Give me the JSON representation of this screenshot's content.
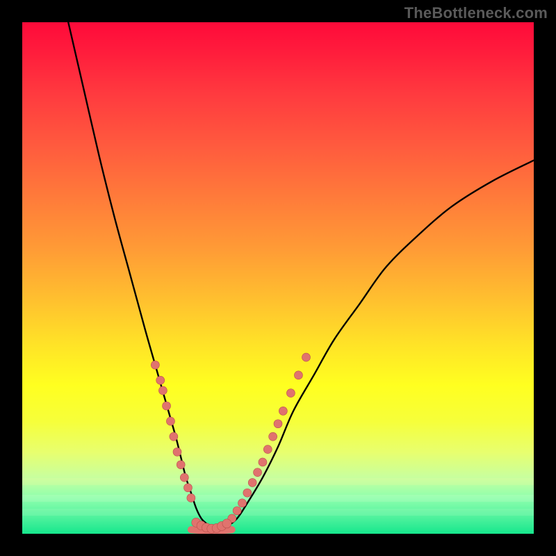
{
  "watermark": "TheBottleneck.com",
  "chart_data": {
    "type": "line",
    "title": "",
    "xlabel": "",
    "ylabel": "",
    "xlim": [
      0,
      100
    ],
    "ylim": [
      0,
      100
    ],
    "grid": false,
    "legend": false,
    "notes": "V-shaped black curve over a vertical red→yellow→green gradient. Red/salmon dots cluster near the valley on both arms; a short salmon stroke traces the very bottom of the V. No axes, ticks, or labels are rendered.",
    "series": [
      {
        "name": "curve",
        "color": "#000000",
        "x": [
          9,
          12,
          15,
          18,
          21,
          24,
          26,
          28,
          30,
          31,
          32,
          33,
          34,
          35,
          36,
          37,
          38,
          40,
          42,
          44,
          47,
          50,
          53,
          57,
          61,
          66,
          71,
          77,
          84,
          92,
          100
        ],
        "y": [
          100,
          87,
          74,
          62,
          51,
          40,
          33,
          26,
          19,
          15,
          11,
          8,
          5,
          3,
          2,
          1.2,
          1.0,
          1.5,
          3,
          6,
          11,
          17,
          24,
          31,
          38,
          45,
          52,
          58,
          64,
          69,
          73
        ]
      }
    ],
    "dots_left_arm": {
      "color": "#e0736e",
      "points": [
        {
          "x": 26,
          "y": 33
        },
        {
          "x": 27,
          "y": 30
        },
        {
          "x": 27.5,
          "y": 28
        },
        {
          "x": 28.2,
          "y": 25
        },
        {
          "x": 29,
          "y": 22
        },
        {
          "x": 29.6,
          "y": 19
        },
        {
          "x": 30.3,
          "y": 16
        },
        {
          "x": 31,
          "y": 13.5
        },
        {
          "x": 31.7,
          "y": 11
        },
        {
          "x": 32.4,
          "y": 9
        },
        {
          "x": 33,
          "y": 7
        }
      ]
    },
    "dots_right_arm": {
      "color": "#e0736e",
      "points": [
        {
          "x": 41,
          "y": 3
        },
        {
          "x": 42,
          "y": 4.5
        },
        {
          "x": 43,
          "y": 6
        },
        {
          "x": 44,
          "y": 8
        },
        {
          "x": 45,
          "y": 10
        },
        {
          "x": 46,
          "y": 12
        },
        {
          "x": 47,
          "y": 14
        },
        {
          "x": 48,
          "y": 16.5
        },
        {
          "x": 49,
          "y": 19
        },
        {
          "x": 50,
          "y": 21.5
        },
        {
          "x": 51,
          "y": 24
        },
        {
          "x": 52.5,
          "y": 27.5
        },
        {
          "x": 54,
          "y": 31
        },
        {
          "x": 55.5,
          "y": 34.5
        }
      ]
    },
    "dots_valley": {
      "color": "#e0736e",
      "points": [
        {
          "x": 34,
          "y": 2.2
        },
        {
          "x": 35,
          "y": 1.6
        },
        {
          "x": 36,
          "y": 1.2
        },
        {
          "x": 37,
          "y": 1.0
        },
        {
          "x": 38,
          "y": 1.1
        },
        {
          "x": 39,
          "y": 1.5
        },
        {
          "x": 40,
          "y": 2.0
        }
      ]
    },
    "bottom_stroke": {
      "color": "#e0736e",
      "x_start": 33,
      "x_end": 41,
      "y": 0.8
    }
  }
}
